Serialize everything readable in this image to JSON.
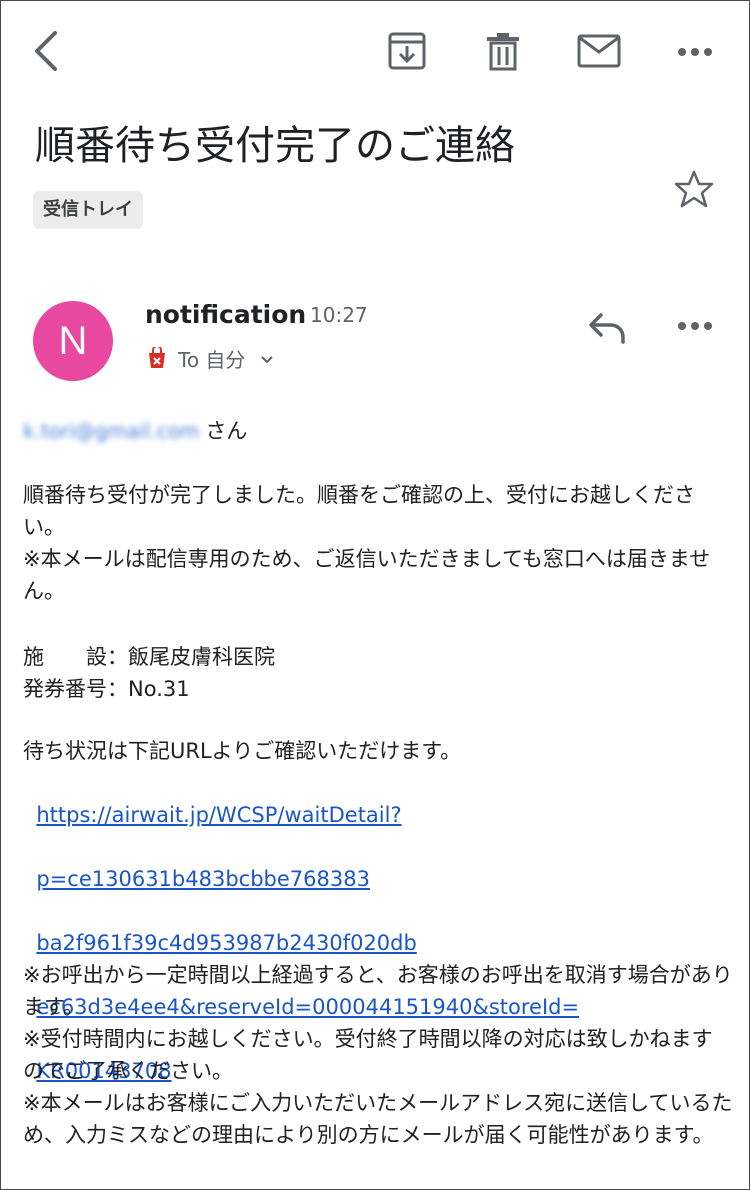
{
  "toolbar": {
    "back": "back-icon",
    "archive": "archive-icon",
    "delete": "trash-icon",
    "mark_unread": "mail-icon",
    "more": "more-icon"
  },
  "email": {
    "subject": "順番待ち受付完了のご連絡",
    "label": "受信トレイ",
    "sender": {
      "initial": "N",
      "name": "notification",
      "time": "10:27",
      "to": "To 自分",
      "avatar_color": "#e8489f"
    },
    "body": {
      "recipient_email": "k.tori@gmail.com",
      "honorific": "さん",
      "para1": "順番待ち受付が完了しました。順番をご確認の上、受付にお越しください。\n※本メールは配信専用のため、ご返信いただきましても窓口へは届きません。",
      "facility_line": "施　　設：飯尾皮膚科医院",
      "ticket_line": "発券番号：No.31",
      "url_intro": "待ち状況は下記URLよりご確認いただけます。",
      "url_lines": [
        "https://airwait.jp/WCSP/waitDetail?",
        "p=ce130631b483bcbbe768383",
        "ba2f961f39c4d953987b2430f020db",
        "ec63d3e4ee4&reserveId=000044151940&storeId=",
        "KR00143708"
      ],
      "notes": "※お呼出から一定時間以上経過すると、お客様のお呼出を取消す場合があります。\n※受付時間内にお越しください。受付終了時間以降の対応は致しかねますのでご了承ください。\n※本メールはお客様にご入力いただいたメールアドレス宛に送信しているため、入力ミスなどの理由により別の方にメールが届く可能性があります。"
    }
  },
  "colors": {
    "link": "#1a55c9",
    "icon": "#5f6368",
    "tag": "#d93025"
  }
}
